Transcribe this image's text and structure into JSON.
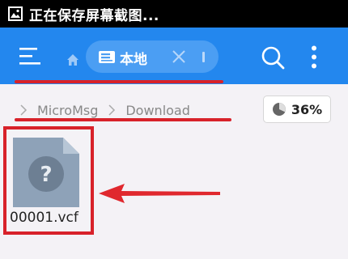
{
  "status_bar": {
    "notification_text": "正在保存屏幕截图...",
    "icon": "image-icon"
  },
  "toolbar": {
    "menu_icon": "hamburger-menu-icon",
    "home_icon": "home-icon",
    "tab": {
      "label": "本地",
      "icon": "disk-icon",
      "close_icon": "close-icon"
    },
    "search_icon": "search-icon",
    "more_icon": "more-vertical-icon",
    "background_color": "#2387ee"
  },
  "breadcrumb": {
    "items": [
      "MicroMsg",
      "Download"
    ]
  },
  "storage": {
    "percent_label": "36%",
    "used_fraction": 0.36
  },
  "files": [
    {
      "name": "00001.vcf",
      "icon": "unknown-file-icon"
    }
  ],
  "annotations": {
    "color": "#d8222a"
  }
}
